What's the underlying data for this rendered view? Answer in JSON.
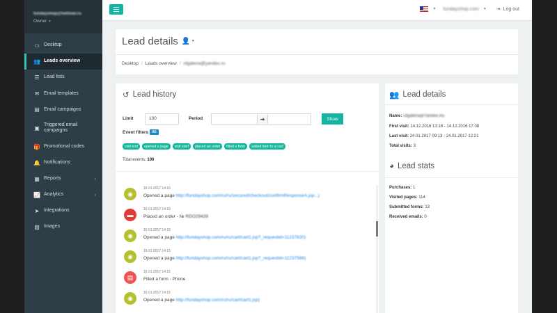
{
  "sidebar": {
    "user_email": "fundayshop@hotmail.ru",
    "role": "Owner",
    "items": [
      {
        "label": "Desktop",
        "icon": "monitor-icon"
      },
      {
        "label": "Leads overview",
        "icon": "users-icon",
        "active": true
      },
      {
        "label": "Lead lists",
        "icon": "list-icon"
      },
      {
        "label": "Email templates",
        "icon": "envelope-icon"
      },
      {
        "label": "Email campaigns",
        "icon": "email-campaign-icon"
      },
      {
        "label": "Triggered email campaigns",
        "icon": "trigger-icon"
      },
      {
        "label": "Promotional codes",
        "icon": "gift-icon"
      },
      {
        "label": "Notifications",
        "icon": "bell-icon"
      },
      {
        "label": "Reports",
        "icon": "report-icon"
      },
      {
        "label": "Analytics",
        "icon": "chart-icon"
      },
      {
        "label": "Integrations",
        "icon": "send-icon"
      },
      {
        "label": "Images",
        "icon": "image-icon"
      }
    ]
  },
  "topbar": {
    "site": "fundayshop.com",
    "logout_label": "Log out",
    "flag": "us-flag-icon"
  },
  "page": {
    "title": "Lead details",
    "breadcrumb": [
      "Desktop",
      "Leads overview",
      "olgalena@yandex.ru"
    ]
  },
  "lead_history": {
    "title": "Lead history",
    "limit_label": "Limit",
    "limit_value": "100",
    "period_label": "Period",
    "show_label": "Show",
    "filters_label": "Event filters",
    "all_label": "All",
    "tags": [
      "visit end",
      "opened a page",
      "visit start",
      "placed an order",
      "filled a form",
      "added item to a cart"
    ],
    "total_label": "Total events:",
    "total_value": "100",
    "events": [
      {
        "time": "16.01.2017 14:16",
        "text": "Opened a page",
        "link": "http://fundayshop.com/ru/ru/secured/checkout/confirmResponseA.jsp...)",
        "type": "view"
      },
      {
        "time": "16.01.2017 14:16",
        "text": "Placed an order - № ",
        "link": "RDO29439",
        "type": "order"
      },
      {
        "time": "16.01.2017 14:16",
        "text": "Opened a page",
        "link": "http://fundayshop.com/ru/ru/cart/cart1.jsp?_requestid=11237630)",
        "type": "view"
      },
      {
        "time": "16.01.2017 14:15",
        "text": "Opened a page",
        "link": "http://fundayshop.com/ru/ru/cart/cart1.jsp?_requestid=11237586)",
        "type": "view"
      },
      {
        "time": "16.01.2017 14:15",
        "text": "Filled a form - Phone",
        "link": "",
        "type": "form"
      },
      {
        "time": "16.01.2017 14:15",
        "text": "Opened a page",
        "link": "http://fundayshop.com/ru/ru/cart/cart1.jsp)",
        "type": "view"
      }
    ]
  },
  "lead_details": {
    "title": "Lead details",
    "name_label": "Name:",
    "name_value": "Olgalena@Yandex.Ru",
    "first_visit_label": "First visit:",
    "first_visit_value": "14.12.2016 13:18 - 14.12.2016 17:08",
    "last_visit_label": "Last visit:",
    "last_visit_value": "24.01.2017 09:13 - 24.01.2017 12:21",
    "total_visits_label": "Total visits:",
    "total_visits_value": "3"
  },
  "lead_stats": {
    "title": "Lead stats",
    "purchases_label": "Purchases:",
    "purchases_value": "1",
    "visited_label": "Visited pages:",
    "visited_value": "114",
    "forms_label": "Submitted forms:",
    "forms_value": "13",
    "emails_label": "Received emails:",
    "emails_value": "0"
  },
  "colors": {
    "accent": "#13b5a2",
    "sidebar": "#2d3e46",
    "link": "#1e88e5"
  }
}
